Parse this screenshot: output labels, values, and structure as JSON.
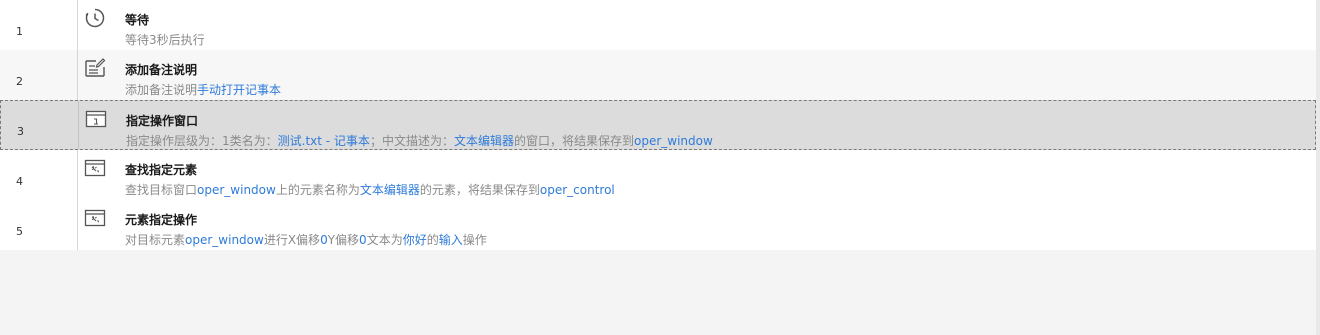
{
  "rows": [
    {
      "num": "1",
      "title": "等待",
      "icon": "clock-icon",
      "desc": [
        {
          "t": "等待3秒后执行",
          "hl": false
        }
      ]
    },
    {
      "num": "2",
      "title": "添加备注说明",
      "icon": "note-icon",
      "desc": [
        {
          "t": "添加备注说明",
          "hl": false
        },
        {
          "t": "手动打开记事本",
          "hl": true
        }
      ]
    },
    {
      "num": "3",
      "title": "指定操作窗口",
      "icon": "window-icon",
      "selected": true,
      "desc": [
        {
          "t": "指定操作层级为：1类名为：",
          "hl": false
        },
        {
          "t": "测试.txt - 记事本",
          "hl": true
        },
        {
          "t": "；中文描述为：",
          "hl": false
        },
        {
          "t": "文本编辑器",
          "hl": true
        },
        {
          "t": "的窗口，将结果保存到",
          "hl": false
        },
        {
          "t": "oper_window",
          "hl": true
        }
      ]
    },
    {
      "num": "4",
      "title": "查找指定元素",
      "icon": "find-element-icon",
      "desc": [
        {
          "t": "查找目标窗口",
          "hl": false
        },
        {
          "t": "oper_window",
          "hl": true
        },
        {
          "t": "上的元素名称为",
          "hl": false
        },
        {
          "t": "文本编辑器",
          "hl": true
        },
        {
          "t": "的元素，将结果保存到",
          "hl": false
        },
        {
          "t": "oper_control",
          "hl": true
        }
      ]
    },
    {
      "num": "5",
      "title": "元素指定操作",
      "icon": "element-action-icon",
      "desc": [
        {
          "t": "对目标元素",
          "hl": false
        },
        {
          "t": "oper_window",
          "hl": true
        },
        {
          "t": "进行X偏移",
          "hl": false
        },
        {
          "t": "0",
          "hl": true
        },
        {
          "t": "Y偏移",
          "hl": false
        },
        {
          "t": "0",
          "hl": true
        },
        {
          "t": "文本为",
          "hl": false
        },
        {
          "t": "你好",
          "hl": true
        },
        {
          "t": "的",
          "hl": false
        },
        {
          "t": "输入",
          "hl": true
        },
        {
          "t": "操作",
          "hl": false
        }
      ]
    }
  ],
  "colors": {
    "highlight": "#2f7bd9",
    "description": "#8a8a8a",
    "selected_row": "#dcdcdc"
  }
}
